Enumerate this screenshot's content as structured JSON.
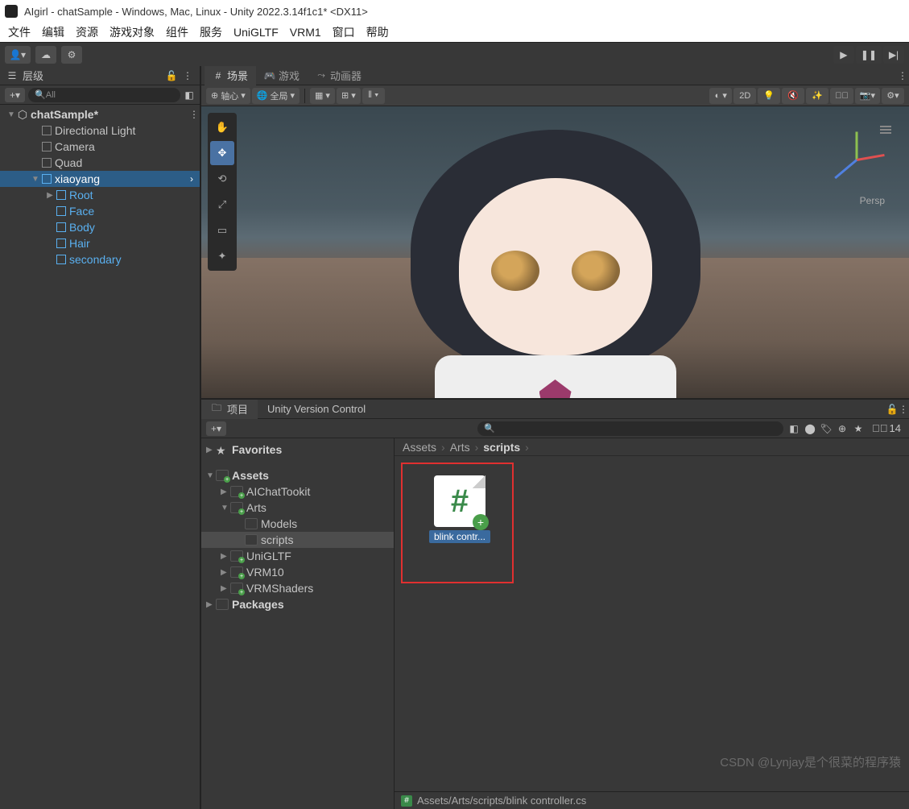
{
  "window": {
    "title": "AIgirl - chatSample - Windows, Mac, Linux - Unity 2022.3.14f1c1* <DX11>"
  },
  "menu": [
    "文件",
    "编辑",
    "资源",
    "游戏对象",
    "组件",
    "服务",
    "UniGLTF",
    "VRM1",
    "窗口",
    "帮助"
  ],
  "toolbar": {
    "account_dropdown": "▾",
    "cloud_icon": "cloud",
    "settings_icon": "gear"
  },
  "hierarchy": {
    "title": "层级",
    "add_label": "+",
    "search_placeholder": "All",
    "root": "chatSample*",
    "items": [
      {
        "name": "Directional Light",
        "depth": 1,
        "prefab": false
      },
      {
        "name": "Camera",
        "depth": 1,
        "prefab": false
      },
      {
        "name": "Quad",
        "depth": 1,
        "prefab": false
      },
      {
        "name": "xiaoyang",
        "depth": 1,
        "prefab": true,
        "expanded": true,
        "selected": true
      },
      {
        "name": "Root",
        "depth": 2,
        "prefab": true,
        "arrow": true
      },
      {
        "name": "Face",
        "depth": 2,
        "prefab": true
      },
      {
        "name": "Body",
        "depth": 2,
        "prefab": true
      },
      {
        "name": "Hair",
        "depth": 2,
        "prefab": true
      },
      {
        "name": "secondary",
        "depth": 2,
        "prefab": true
      }
    ]
  },
  "scene_tabs": [
    {
      "label": "场景",
      "active": true,
      "icon": "#"
    },
    {
      "label": "游戏",
      "active": false,
      "icon": "gamepad"
    },
    {
      "label": "动画器",
      "active": false,
      "icon": "anim"
    }
  ],
  "scene_toolbar": {
    "pivot": "轴心",
    "global": "全局",
    "btn_2d": "2D",
    "persp_label": "Persp"
  },
  "project": {
    "tabs": [
      {
        "label": "项目",
        "active": true
      },
      {
        "label": "Unity Version Control",
        "active": false
      }
    ],
    "add_label": "+",
    "hidden_count": "14",
    "favorites": "Favorites",
    "assets_root": "Assets",
    "tree": [
      {
        "name": "AIChatTookit",
        "depth": 1
      },
      {
        "name": "Arts",
        "depth": 1,
        "expanded": true
      },
      {
        "name": "Models",
        "depth": 2
      },
      {
        "name": "scripts",
        "depth": 2,
        "selected": true
      },
      {
        "name": "UniGLTF",
        "depth": 1
      },
      {
        "name": "VRM10",
        "depth": 1
      },
      {
        "name": "VRMShaders",
        "depth": 1
      }
    ],
    "packages": "Packages",
    "breadcrumb": [
      "Assets",
      "Arts",
      "scripts"
    ],
    "asset_label": "blink contr...",
    "status_path": "Assets/Arts/scripts/blink controller.cs"
  },
  "watermark": "CSDN @Lynjay是个很菜的程序猿"
}
